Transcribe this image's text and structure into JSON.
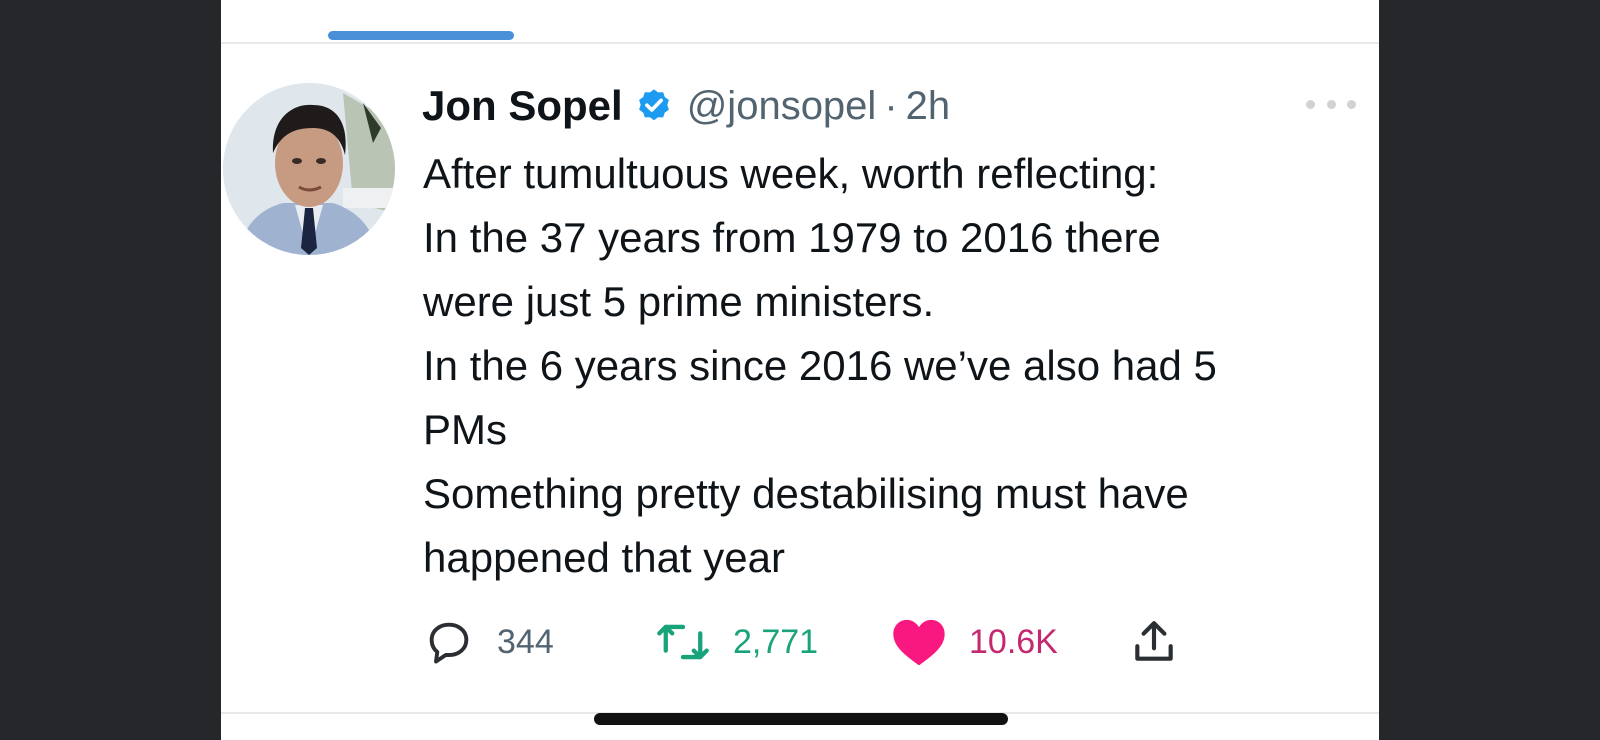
{
  "tweet": {
    "author_name": "Jon Sopel",
    "handle": "@jonsopel",
    "separator": "·",
    "time": "2h",
    "lines": [
      "After tumultuous week, worth reflecting:",
      "In the 37 years from 1979 to 2016 there",
      "were just 5 prime ministers.",
      "In the 6 years since 2016 we’ve also had 5",
      "PMs",
      "Something pretty destabilising must have",
      "happened that year"
    ]
  },
  "actions": {
    "reply_count": "344",
    "retweet_count": "2,771",
    "like_count": "10.6K"
  },
  "colors": {
    "verified": "#1d9bf0",
    "retweet": "#19a37a",
    "like": "#f91880",
    "tab_indicator": "#4a90d9"
  },
  "icons": {
    "verified": "verified-badge-icon",
    "more": "more-icon",
    "reply": "reply-icon",
    "retweet": "retweet-icon",
    "like": "heart-icon",
    "share": "share-icon"
  }
}
